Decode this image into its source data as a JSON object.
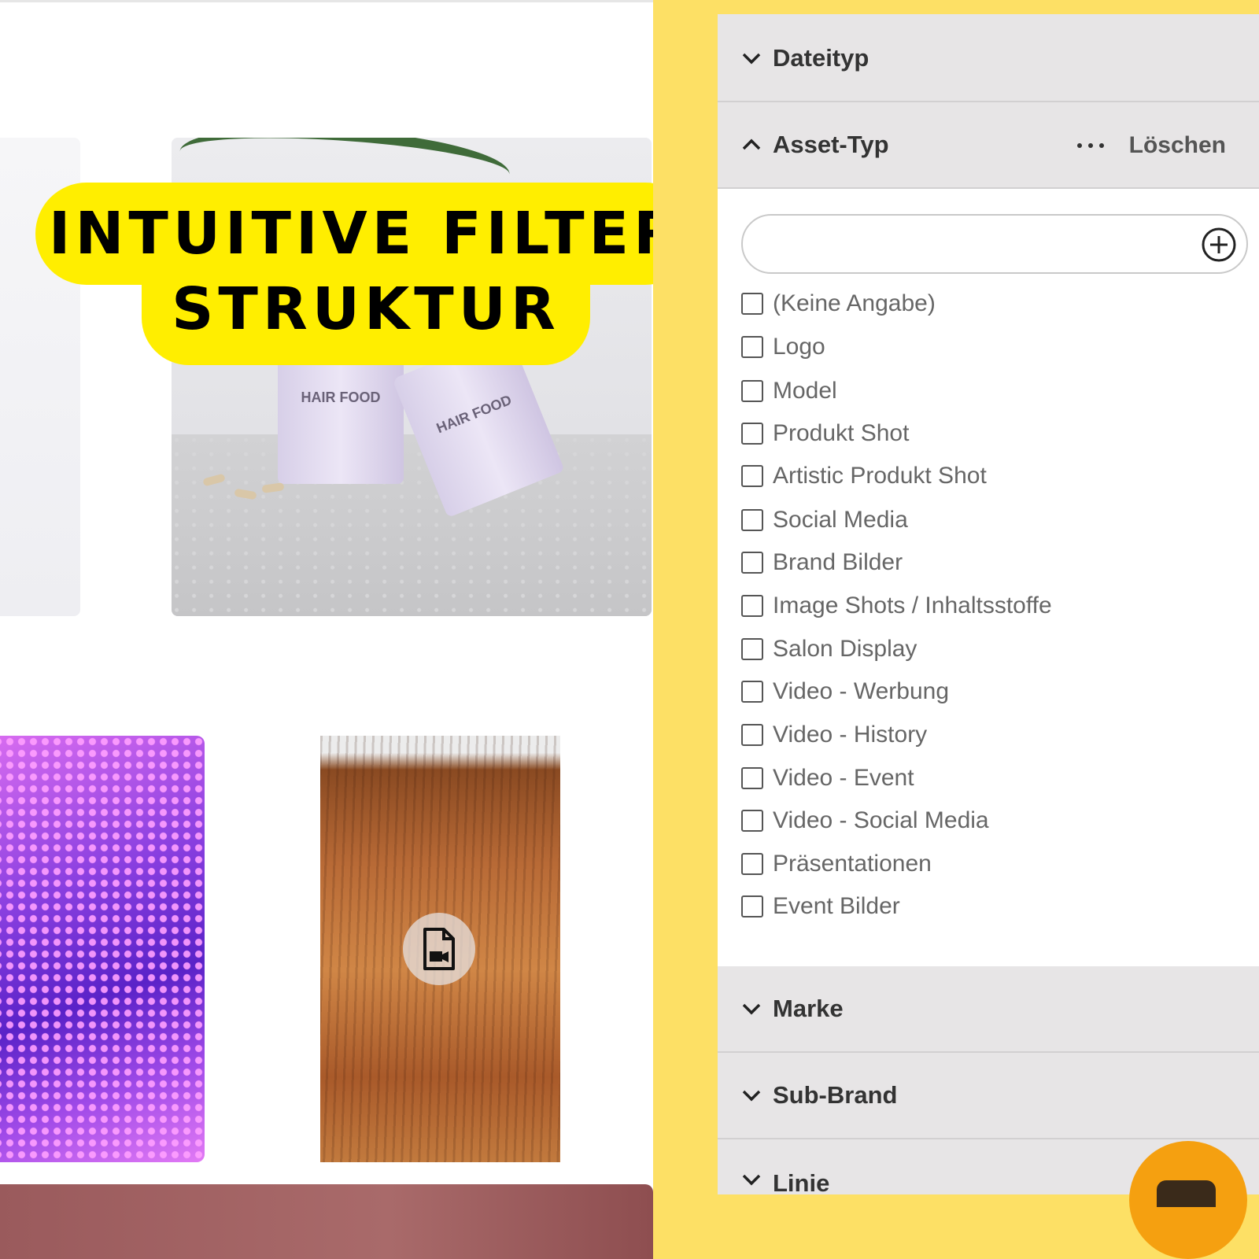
{
  "banner": {
    "line1": "INTUITIVE FILTER",
    "line2": "STRUKTUR",
    "color": "#ffee00"
  },
  "gallery": {
    "product_label": "HAIR FOOD",
    "video_icon": "video-file-icon"
  },
  "filter_panel": {
    "accent_bg": "#fde065",
    "sections": {
      "dateityp": {
        "title": "Dateityp",
        "state": "collapsed"
      },
      "asset_typ": {
        "title": "Asset-Typ",
        "state": "expanded",
        "more_icon": "more-dots-icon",
        "clear_label": "Löschen",
        "search_value": "",
        "add_icon": "plus-circle-icon",
        "options": [
          {
            "label": "(Keine Angabe)",
            "checked": false
          },
          {
            "label": "Logo",
            "checked": false
          },
          {
            "label": "Model",
            "checked": false
          },
          {
            "label": "Produkt Shot",
            "checked": false
          },
          {
            "label": "Artistic Produkt Shot",
            "checked": false
          },
          {
            "label": "Social Media",
            "checked": false
          },
          {
            "label": "Brand Bilder",
            "checked": false
          },
          {
            "label": "Image Shots / Inhaltsstoffe",
            "checked": false
          },
          {
            "label": "Salon Display",
            "checked": false
          },
          {
            "label": "Video - Werbung",
            "checked": false
          },
          {
            "label": "Video - History",
            "checked": false
          },
          {
            "label": "Video - Event",
            "checked": false
          },
          {
            "label": "Video - Social Media",
            "checked": false
          },
          {
            "label": "Präsentationen",
            "checked": false
          },
          {
            "label": "Event Bilder",
            "checked": false
          }
        ]
      },
      "marke": {
        "title": "Marke",
        "state": "collapsed"
      },
      "sub_brand": {
        "title": "Sub-Brand",
        "state": "collapsed"
      },
      "linie": {
        "title": "Linie",
        "state": "collapsed"
      }
    }
  }
}
